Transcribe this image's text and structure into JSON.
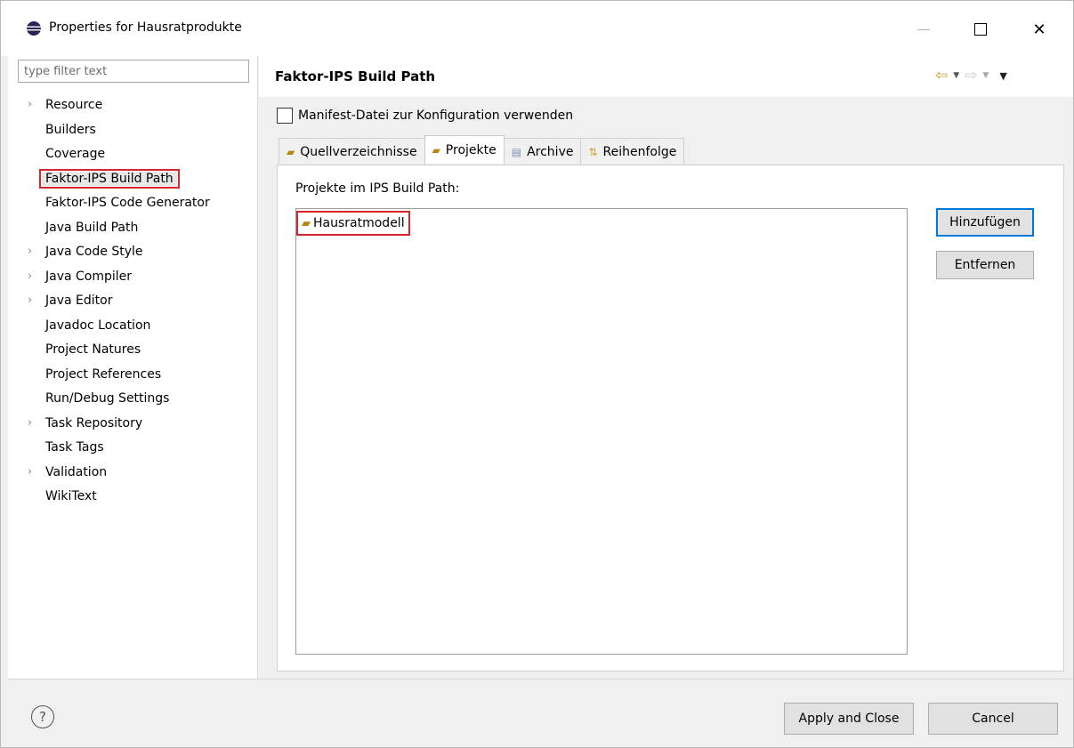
{
  "window": {
    "title": "Properties for Hausratprodukte",
    "close_glyph": "✕"
  },
  "filter": {
    "placeholder": "type filter text"
  },
  "tree": [
    {
      "label": "Resource",
      "expandable": true
    },
    {
      "label": "Builders",
      "expandable": false
    },
    {
      "label": "Coverage",
      "expandable": false
    },
    {
      "label": "Faktor-IPS Build Path",
      "expandable": false,
      "selected": true
    },
    {
      "label": "Faktor-IPS Code Generator",
      "expandable": false
    },
    {
      "label": "Java Build Path",
      "expandable": false
    },
    {
      "label": "Java Code Style",
      "expandable": true
    },
    {
      "label": "Java Compiler",
      "expandable": true
    },
    {
      "label": "Java Editor",
      "expandable": true
    },
    {
      "label": "Javadoc Location",
      "expandable": false
    },
    {
      "label": "Project Natures",
      "expandable": false
    },
    {
      "label": "Project References",
      "expandable": false
    },
    {
      "label": "Run/Debug Settings",
      "expandable": false
    },
    {
      "label": "Task Repository",
      "expandable": true
    },
    {
      "label": "Task Tags",
      "expandable": false
    },
    {
      "label": "Validation",
      "expandable": true
    },
    {
      "label": "WikiText",
      "expandable": false
    }
  ],
  "page": {
    "title": "Faktor-IPS Build Path",
    "manifest_label": "Manifest-Datei zur Konfiguration verwenden",
    "tabs": [
      {
        "label": "Quellverzeichnisse",
        "icon": "source-folder-icon"
      },
      {
        "label": "Projekte",
        "icon": "ips-project-icon",
        "active": true
      },
      {
        "label": "Archive",
        "icon": "archive-icon"
      },
      {
        "label": "Reihenfolge",
        "icon": "order-icon"
      }
    ],
    "panel_label": "Projekte im IPS Build Path:",
    "projects": [
      "Hausratmodell"
    ],
    "add_button": "Hinzufügen",
    "remove_button": "Entfernen"
  },
  "footer": {
    "help_glyph": "?",
    "apply_button": "Apply and Close",
    "cancel_button": "Cancel"
  },
  "colors": {
    "highlight_box": "#d6262b",
    "focus_border": "#0078d7",
    "nav_back": "#d29a23"
  }
}
